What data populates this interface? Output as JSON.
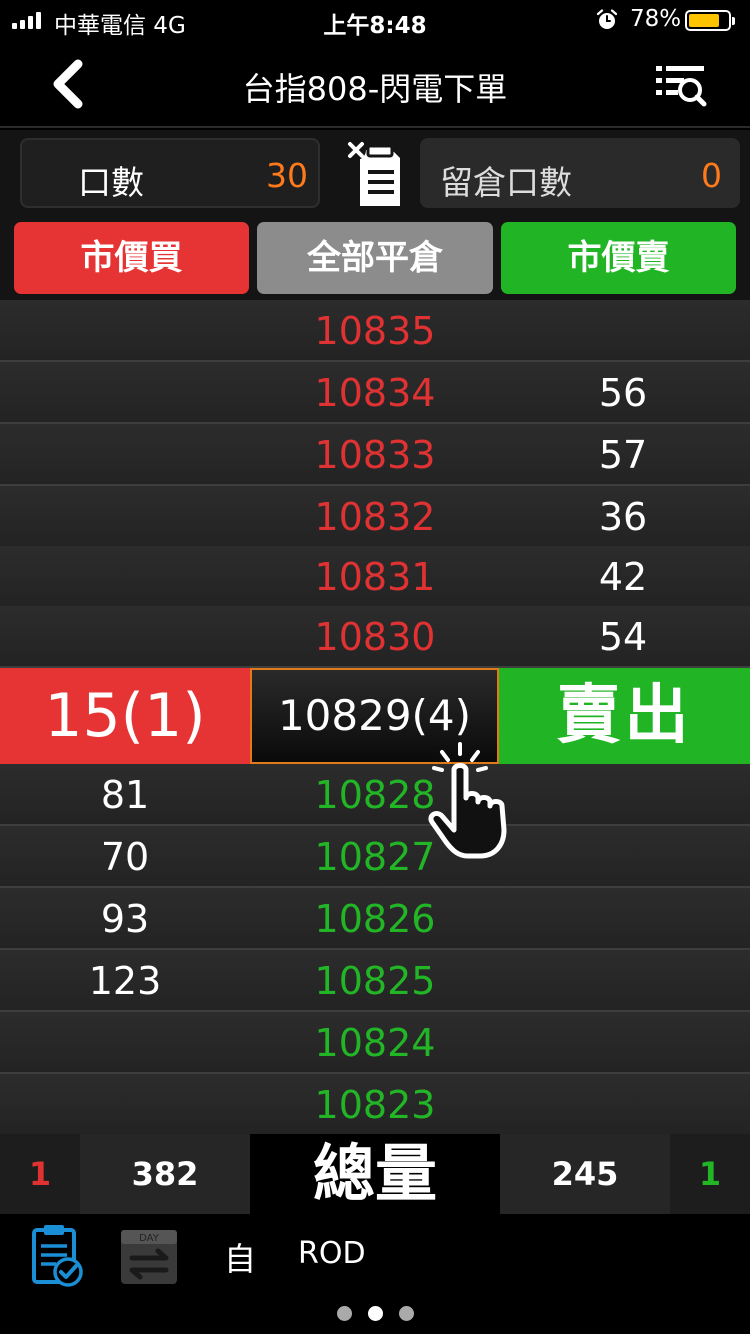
{
  "status_bar": {
    "carrier": "中華電信  4G",
    "time": "上午8:48",
    "battery": "78%",
    "battery_level": 0.78,
    "icons": [
      "signal-icon",
      "alarm-icon",
      "battery-icon"
    ]
  },
  "header": {
    "title": "台指808-閃電下單",
    "back_icon": "chevron-left-icon",
    "menu_icon": "list-search-icon"
  },
  "quantity": {
    "lots_label": "口數",
    "lots_value": "30",
    "position_label": "留倉口數",
    "position_value": "0"
  },
  "actions": {
    "market_buy": "市價買",
    "close_all": "全部平倉",
    "market_sell": "市價賣"
  },
  "ask_rows": [
    {
      "price": "10835",
      "ask": ""
    },
    {
      "price": "10834",
      "ask": "56"
    },
    {
      "price": "10833",
      "ask": "57"
    },
    {
      "price": "10832",
      "ask": "36"
    },
    {
      "price": "10831",
      "ask": "42"
    },
    {
      "price": "10830",
      "ask": "54"
    }
  ],
  "center": {
    "buy_label": "15(1)",
    "last_price": "10829(4)",
    "sell_label": "賣出"
  },
  "bid_rows": [
    {
      "bid": "81",
      "price": "10828"
    },
    {
      "bid": "70",
      "price": "10827"
    },
    {
      "bid": "93",
      "price": "10826"
    },
    {
      "bid": "123",
      "price": "10825"
    },
    {
      "bid": "",
      "price": "10824"
    },
    {
      "bid": "",
      "price": "10823"
    }
  ],
  "totals": {
    "buy_count": "1",
    "buy_volume": "382",
    "label": "總量",
    "sell_volume": "245",
    "sell_count": "1"
  },
  "bottom": {
    "self_label": "自",
    "order_type": "ROD",
    "day_icon_text": "DAY",
    "page_dots": 3,
    "active_dot": 1
  },
  "colors": {
    "buy_red": "#e63434",
    "sell_green": "#21b526",
    "neutral_gray": "#8c8c8c",
    "accent_orange": "#ff7a1a",
    "battery_yellow": "#ffc400",
    "icon_blue": "#1a8fd6"
  }
}
